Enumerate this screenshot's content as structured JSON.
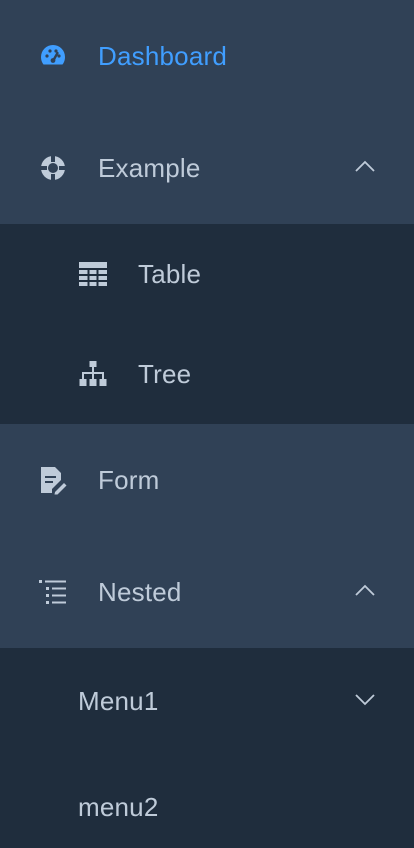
{
  "sidebar": {
    "items": [
      {
        "label": "Dashboard",
        "icon": "dashboard-icon",
        "active": true
      },
      {
        "label": "Example",
        "icon": "example-icon",
        "expanded": true,
        "children": [
          {
            "label": "Table",
            "icon": "table-icon"
          },
          {
            "label": "Tree",
            "icon": "tree-icon"
          }
        ]
      },
      {
        "label": "Form",
        "icon": "form-icon"
      },
      {
        "label": "Nested",
        "icon": "nested-icon",
        "expanded": true,
        "children": [
          {
            "label": "Menu1",
            "collapsed": true
          },
          {
            "label": "menu2"
          }
        ]
      }
    ]
  },
  "colors": {
    "background": "#304156",
    "submenu_background": "#1f2d3d",
    "text": "#bfcbd9",
    "active": "#409eff"
  }
}
